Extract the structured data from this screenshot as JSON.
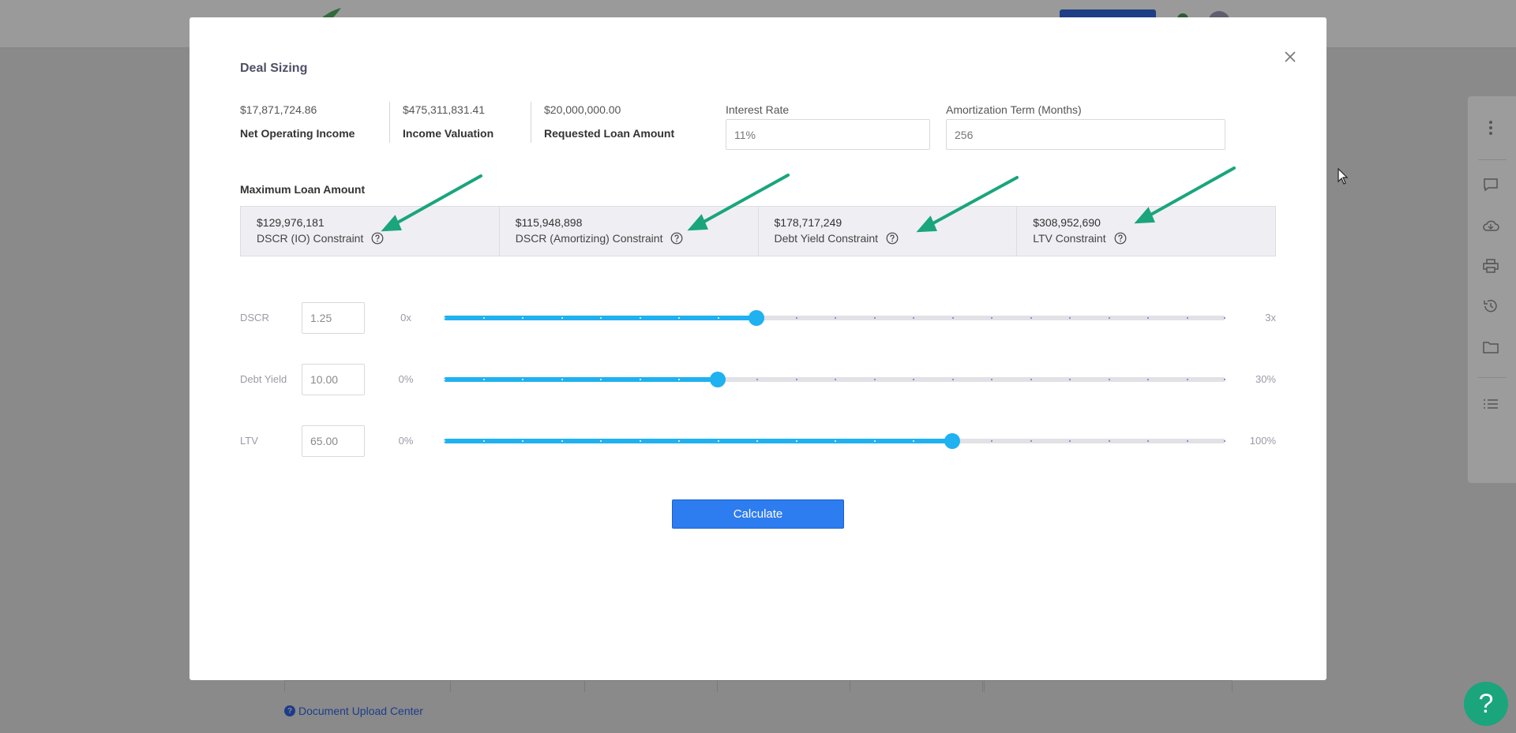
{
  "background": {
    "link_text": "Document Upload Center",
    "help_label": "?",
    "colors": {
      "header_button": "#1e3f86",
      "help_fab": "#1aa57c"
    },
    "sidebar_icons": [
      "more-vertical-icon",
      "comment-icon",
      "cloud-icon",
      "print-icon",
      "history-icon",
      "folder-icon",
      "list-icon"
    ]
  },
  "modal": {
    "title": "Deal Sizing",
    "stats": [
      {
        "value": "$17,871,724.86",
        "label": "Net Operating Income"
      },
      {
        "value": "$475,311,831.41",
        "label": "Income Valuation"
      },
      {
        "value": "$20,000,000.00",
        "label": "Requested Loan Amount"
      }
    ],
    "interest_rate": {
      "label": "Interest Rate",
      "placeholder": "11%"
    },
    "amortization": {
      "label": "Amortization Term (Months)",
      "placeholder": "256"
    },
    "max_loan": {
      "label": "Maximum Loan Amount",
      "constraints": [
        {
          "value": "$129,976,181",
          "label": "DSCR (IO) Constraint"
        },
        {
          "value": "$115,948,898",
          "label": "DSCR (Amortizing) Constraint"
        },
        {
          "value": "$178,717,249",
          "label": "Debt Yield Constraint"
        },
        {
          "value": "$308,952,690",
          "label": "LTV Constraint"
        }
      ]
    },
    "sliders": [
      {
        "label": "DSCR",
        "value": "1.25",
        "min_label": "0x",
        "max_label": "3x",
        "fraction": 0.4
      },
      {
        "label": "Debt Yield",
        "value": "10.00",
        "min_label": "0%",
        "max_label": "30%",
        "fraction": 0.35
      },
      {
        "label": "LTV",
        "value": "65.00",
        "min_label": "0%",
        "max_label": "100%",
        "fraction": 0.65
      }
    ],
    "calculate_label": "Calculate",
    "colors": {
      "accent": "#1fb1f0",
      "button": "#2d7cf0",
      "annotation_arrow": "#1aa57c"
    }
  }
}
